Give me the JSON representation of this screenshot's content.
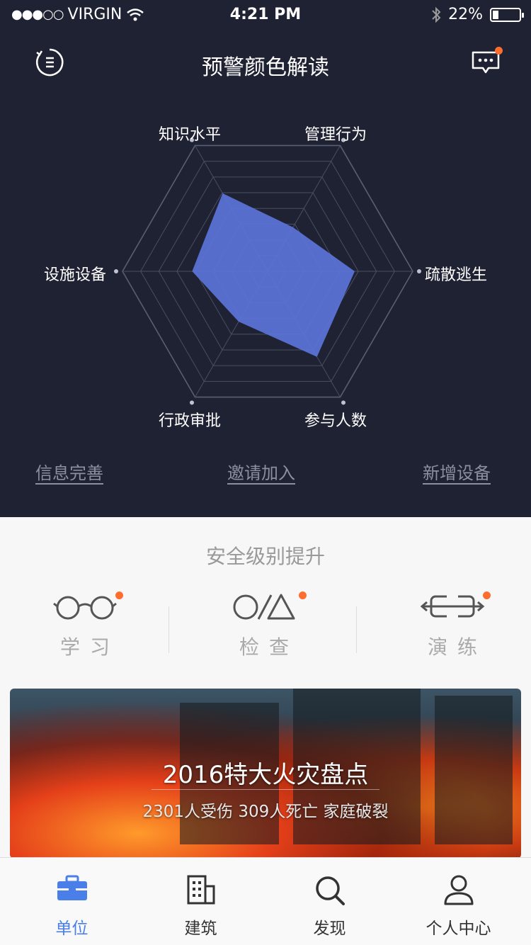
{
  "status_bar": {
    "carrier": "VIRGIN",
    "time": "4:21 PM",
    "battery": "22%",
    "battery_level": 0.22
  },
  "header": {
    "title": "预警颜色解读",
    "menu_icon": "menu-circle-icon",
    "chat_icon": "chat-bubble-icon"
  },
  "radar": {
    "labels": [
      "知识水平",
      "管理行为",
      "疏散逃生",
      "参与人数",
      "行政审批",
      "设施设备"
    ],
    "values": [
      0.62,
      0.35,
      0.6,
      0.68,
      0.4,
      0.52
    ],
    "fill_color": "#5b74d9",
    "grid_color": "#4a4e63"
  },
  "links": {
    "info": "信息完善",
    "invite": "邀请加入",
    "add_device": "新增设备"
  },
  "section": {
    "title": "安全级别提升"
  },
  "actions": [
    {
      "label": "学习",
      "icon": "glasses-icon"
    },
    {
      "label": "检查",
      "icon": "shapes-icon"
    },
    {
      "label": "演练",
      "icon": "drill-arrows-icon"
    }
  ],
  "banner": {
    "headline": "2016特大火灾盘点",
    "subtitle": "2301人受伤 309人死亡 家庭破裂"
  },
  "tabs": [
    {
      "label": "单位",
      "icon": "briefcase-icon",
      "active": true
    },
    {
      "label": "建筑",
      "icon": "building-icon",
      "active": false
    },
    {
      "label": "发现",
      "icon": "search-icon",
      "active": false
    },
    {
      "label": "个人中心",
      "icon": "user-icon",
      "active": false
    }
  ],
  "colors": {
    "header_bg": "#1f2233",
    "accent": "#4a7ee8",
    "badge": "#ff6d2e"
  }
}
